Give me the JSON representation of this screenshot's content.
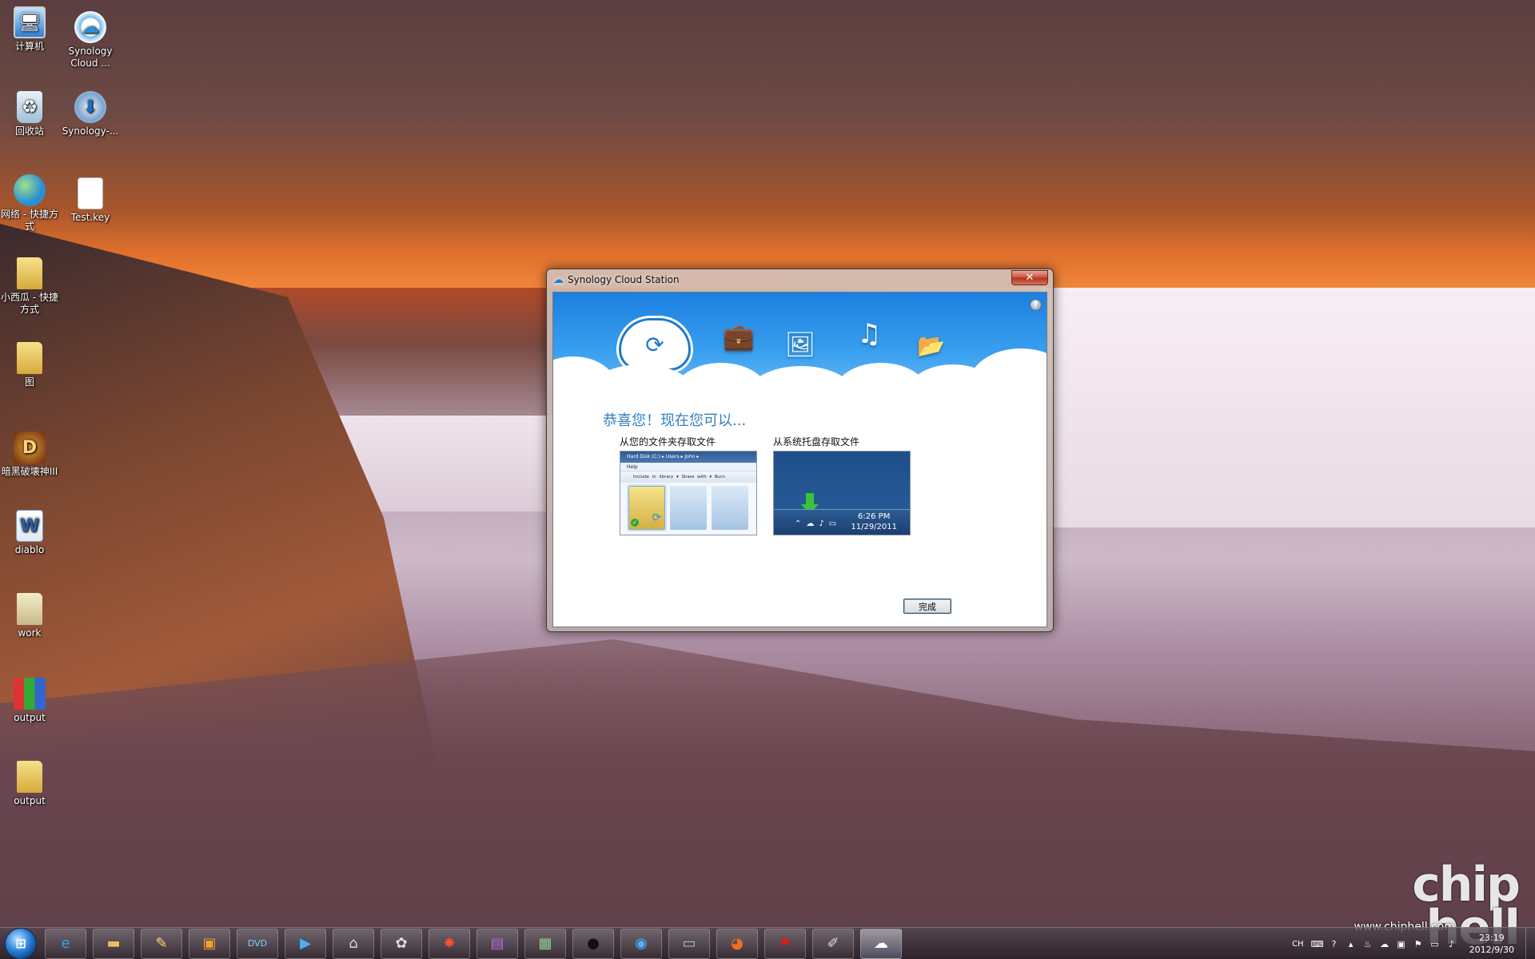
{
  "desktop": {
    "icons": [
      {
        "label": "计算机",
        "icon": "computer-icon"
      },
      {
        "label": "Synology Cloud ...",
        "icon": "cloud-shortcut-icon"
      },
      {
        "label": "回收站",
        "icon": "recycle-bin-icon"
      },
      {
        "label": "Synology-...",
        "icon": "installer-disc-icon"
      },
      {
        "label": "网络 - 快捷方式",
        "icon": "network-icon"
      },
      {
        "label": "Test.key",
        "icon": "file-icon"
      },
      {
        "label": "小西瓜 - 快捷方式",
        "icon": "folder-shortcut-icon"
      },
      {
        "label": "图",
        "icon": "folder-icon"
      },
      {
        "label": "暗黑破壊神III",
        "icon": "diablo-icon"
      },
      {
        "label": "diablo",
        "icon": "word-document-icon"
      },
      {
        "label": "work",
        "icon": "folder-icon"
      },
      {
        "label": "output",
        "icon": "archive-icon"
      },
      {
        "label": "output",
        "icon": "folder-icon"
      }
    ]
  },
  "dialog": {
    "title": "Synology Cloud Station",
    "close_label": "✕",
    "help_label": "?",
    "heading": "恭喜您！现在您可以...",
    "left_label": "从您的文件夹存取文件",
    "right_label": "从系统托盘存取文件",
    "finish_label": "完成",
    "folder_preview": {
      "address": "Hard Disk (C:)  ▸  Users  ▸  John  ▸",
      "menu": "Help",
      "toolbar": "Include in library ▾   Share with ▾   Burn"
    },
    "tray_preview": {
      "time": "6:26 PM",
      "date": "11/29/2011"
    }
  },
  "taskbar": {
    "apps": [
      "internet-explorer",
      "file-explorer",
      "paint-brushes",
      "media-player",
      "dvd-app",
      "play-app",
      "network-app",
      "puzzle-app",
      "fireworks-app",
      "open-app",
      "spreadsheet-app",
      "qq-app",
      "chat-app",
      "remote-desktop-app",
      "firefox-app",
      "pdf-app",
      "paint-app",
      "cloud-station-app"
    ],
    "tray": {
      "lang": "CH",
      "clock_time": "23:19",
      "clock_date": "2012/9/30"
    }
  },
  "watermark": {
    "logo": "chip hell",
    "url": "www.chiphell.com"
  },
  "colors": {
    "banner": "#1b7fe0",
    "heading": "#2f7fc0",
    "close": "#c9503a"
  }
}
